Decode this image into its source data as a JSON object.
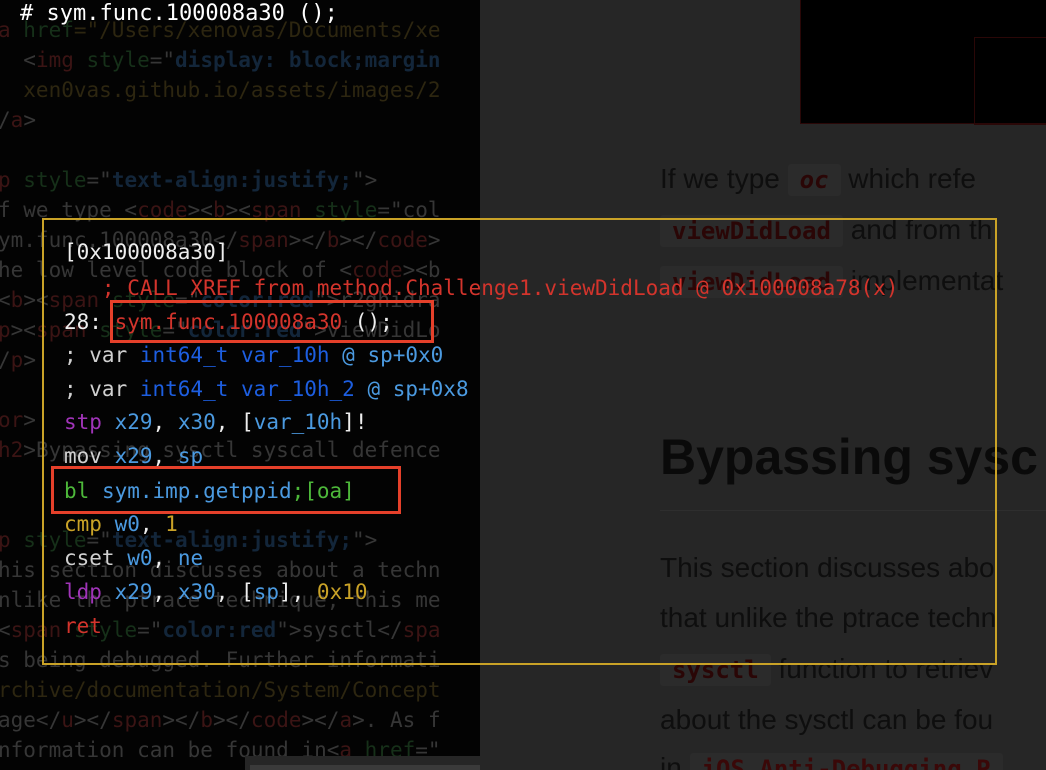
{
  "title": "# sym.func.100008a30 ();",
  "background_source": [
    [
      [
        "a ",
        "tag"
      ],
      [
        "href",
        "attr"
      ],
      [
        "=\"/Users/xenovas/Documents/xe",
        "path"
      ]
    ],
    [
      [
        "  <",
        "txt"
      ],
      [
        "img",
        "tag"
      ],
      [
        " style",
        "attr"
      ],
      [
        "=\"",
        "txt"
      ],
      [
        "display: block;margin",
        "val"
      ]
    ],
    [
      [
        "  xen0vas.github.io/assets/images/2",
        "path"
      ]
    ],
    [
      [
        "/",
        "txt"
      ],
      [
        "a",
        "tag"
      ],
      [
        ">",
        "txt"
      ]
    ],
    [
      [
        "",
        "txt"
      ]
    ],
    [
      [
        "p",
        "tag"
      ],
      [
        " style",
        "attr"
      ],
      [
        "=\"",
        "txt"
      ],
      [
        "text-align:justify;",
        "val"
      ],
      [
        "\">",
        "txt"
      ]
    ],
    [
      [
        "f we type <",
        "txt"
      ],
      [
        "code",
        "tag"
      ],
      [
        "><",
        "txt"
      ],
      [
        "b",
        "tag"
      ],
      [
        "><",
        "txt"
      ],
      [
        "span",
        "tag"
      ],
      [
        " style",
        "attr"
      ],
      [
        "=\"col",
        "txt"
      ]
    ],
    [
      [
        "ym.func.100008a30</",
        "txt"
      ],
      [
        "span",
        "tag"
      ],
      [
        "></",
        "txt"
      ],
      [
        "b",
        "tag"
      ],
      [
        "></",
        "txt"
      ],
      [
        "code",
        "tag"
      ],
      [
        ">",
        "txt"
      ]
    ],
    [
      [
        "he low level code block of <",
        "txt"
      ],
      [
        "code",
        "tag"
      ],
      [
        "><b",
        "txt"
      ]
    ],
    [
      [
        "<",
        "txt"
      ],
      [
        "b",
        "tag"
      ],
      [
        "><",
        "txt"
      ],
      [
        "span",
        "tag"
      ],
      [
        " style",
        "attr"
      ],
      [
        "=\"",
        "txt"
      ],
      [
        "color:red",
        "val"
      ],
      [
        "\">r2ghidra",
        "txt"
      ]
    ],
    [
      [
        "p",
        "tag"
      ],
      [
        "><",
        "txt"
      ],
      [
        "span",
        "tag"
      ],
      [
        " style",
        "attr"
      ],
      [
        "=\"",
        "txt"
      ],
      [
        "color:red",
        "val"
      ],
      [
        "\">viewDidLo",
        "txt"
      ]
    ],
    [
      [
        "/",
        "txt"
      ],
      [
        "p",
        "tag"
      ],
      [
        ">",
        "txt"
      ]
    ],
    [
      [
        "",
        "txt"
      ]
    ],
    [
      [
        "or",
        "tag"
      ],
      [
        ">",
        "txt"
      ]
    ],
    [
      [
        "h2",
        "tag"
      ],
      [
        ">Bypassing sysctl syscall defence",
        "txt"
      ]
    ],
    [
      [
        "",
        "txt"
      ]
    ],
    [
      [
        "",
        "txt"
      ]
    ],
    [
      [
        "p",
        "tag"
      ],
      [
        " style",
        "attr"
      ],
      [
        "=\"",
        "txt"
      ],
      [
        "text-align:justify;",
        "val"
      ],
      [
        "\">",
        "txt"
      ]
    ],
    [
      [
        "his section discusses about a techn",
        "txt"
      ]
    ],
    [
      [
        "nlike the ptrace technique, this me",
        "txt"
      ]
    ],
    [
      [
        "<",
        "txt"
      ],
      [
        "span",
        "tag"
      ],
      [
        " style",
        "attr"
      ],
      [
        "=\"",
        "txt"
      ],
      [
        "color:red",
        "val"
      ],
      [
        "\">sysctl</",
        "txt"
      ],
      [
        "spa",
        "tag"
      ]
    ],
    [
      [
        "s being debugged. Further informati",
        "txt"
      ]
    ],
    [
      [
        "rchive/documentation/System/Concept",
        "path"
      ]
    ],
    [
      [
        "age</",
        "txt"
      ],
      [
        "u",
        "tag"
      ],
      [
        "></",
        "txt"
      ],
      [
        "span",
        "tag"
      ],
      [
        "></",
        "txt"
      ],
      [
        "b",
        "tag"
      ],
      [
        "></",
        "txt"
      ],
      [
        "code",
        "tag"
      ],
      [
        "></",
        "txt"
      ],
      [
        "a",
        "tag"
      ],
      [
        ">. As f",
        "txt"
      ]
    ],
    [
      [
        "nformation can be found in<",
        "txt"
      ],
      [
        "a",
        "tag"
      ],
      [
        " href",
        "attr"
      ],
      [
        "=\"",
        "txt"
      ]
    ]
  ],
  "article": {
    "p1_line1": {
      "before": "If we type ",
      "code": "oc",
      "after": " which refe"
    },
    "p1_line2": {
      "code": "viewDidLoad",
      "after": " and from th"
    },
    "p1_line3": {
      "code": "viewDidLoad",
      "after": " implementat"
    },
    "heading": "Bypassing sysc",
    "p2_line1": "This section discusses abo",
    "p2_line2": "that unlike the ptrace techn",
    "p2_line3": {
      "code": "sysctl",
      "after": " function to retriev"
    },
    "p2_line4": "about the sysctl can be fou",
    "p2_line5": {
      "before": "in ",
      "code": "iOS Anti-Debugging P"
    }
  },
  "disassembly": {
    "border_color": "#c9a227",
    "highlight_color": "#e5402a",
    "lines": [
      [
        [
          "[0x100008a30]",
          "w"
        ]
      ],
      [
        [
          "   ; CALL XREF from method.Challenge1.viewDidLoad @ 0x100008a78(x)",
          "r"
        ]
      ],
      [
        [
          "28: ",
          "w"
        ],
        [
          "sym.func.100008a30",
          "r"
        ],
        [
          " ();",
          "w"
        ]
      ],
      [
        [
          "; var ",
          "gw"
        ],
        [
          "int64_t var_10h",
          "db"
        ],
        [
          " @ sp+0x0",
          "lb"
        ]
      ],
      [
        [
          "; var ",
          "gw"
        ],
        [
          "int64_t var_10h_2",
          "db"
        ],
        [
          " @ sp+0x8",
          "lb"
        ]
      ],
      [
        [
          "stp ",
          "p"
        ],
        [
          "x29",
          "lb"
        ],
        [
          ", ",
          "w"
        ],
        [
          "x30",
          "lb"
        ],
        [
          ", [",
          "w"
        ],
        [
          "var_10h",
          "lb"
        ],
        [
          "]!",
          "w"
        ]
      ],
      [
        [
          "mov ",
          "gw"
        ],
        [
          "x29",
          "lb"
        ],
        [
          ", ",
          "w"
        ],
        [
          "sp",
          "lb"
        ]
      ],
      [
        [
          "bl ",
          "g"
        ],
        [
          "sym.imp.getppid",
          "lb"
        ],
        [
          ";[oa]",
          "g"
        ]
      ],
      [
        [
          "cmp ",
          "y"
        ],
        [
          "w0",
          "lb"
        ],
        [
          ", ",
          "w"
        ],
        [
          "1",
          "y"
        ]
      ],
      [
        [
          "cset ",
          "gw"
        ],
        [
          "w0",
          "lb"
        ],
        [
          ", ",
          "w"
        ],
        [
          "ne",
          "lb"
        ]
      ],
      [
        [
          "ldp ",
          "p"
        ],
        [
          "x29",
          "lb"
        ],
        [
          ", ",
          "w"
        ],
        [
          "x30",
          "lb"
        ],
        [
          ", [",
          "w"
        ],
        [
          "sp",
          "lb"
        ],
        [
          "], ",
          "w"
        ],
        [
          "0x10",
          "y"
        ]
      ],
      [
        [
          "ret",
          "r"
        ]
      ]
    ]
  }
}
